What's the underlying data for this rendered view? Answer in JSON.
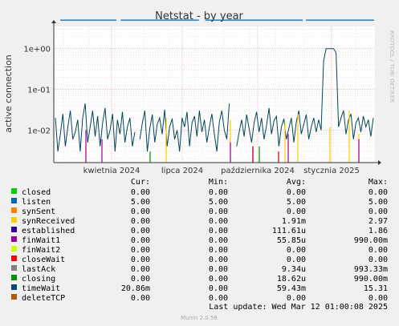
{
  "chart_data": {
    "type": "line",
    "title": "Netstat - by year",
    "ylabel": "active connection",
    "yscale": "log",
    "ylim": [
      0.0016,
      3.5
    ],
    "y_ticks": [
      {
        "v": 1,
        "label": "1e+00"
      },
      {
        "v": 0.1,
        "label": "1e-01"
      },
      {
        "v": 0.01,
        "label": "1e-02"
      }
    ],
    "x_ticks": [
      "kwietnia 2024",
      "lipca 2024",
      "października 2024",
      "stycznia 2025"
    ],
    "side_label": "RRDTOOL / TOBI OETIKER",
    "grid": true,
    "series": [
      {
        "name": "listen",
        "color": "#0066b3",
        "segments": [
          [
            0.02,
            0.195
          ],
          [
            0.208,
            0.452
          ],
          [
            0.472,
            0.775
          ],
          [
            0.785,
            0.997
          ]
        ],
        "level": 5.0
      },
      {
        "name": "timeWait",
        "color": "#00455a",
        "values": [
          0.02,
          0.003,
          0.008,
          0.025,
          0.004,
          0.012,
          0.03,
          0.006,
          0.009,
          0.018,
          0.003,
          0.02,
          0.045,
          0.005,
          0.012,
          0.03,
          0.007,
          0.022,
          0.004,
          0.015,
          0.035,
          0.006,
          0.01,
          0.025,
          0.003,
          0.018,
          0.008,
          0.028,
          0.005,
          0.012,
          0.02,
          0.004,
          0.009,
          0.022,
          0.006,
          0.015,
          0.03,
          0.003,
          0.011,
          0.024,
          0.005,
          0.014,
          0.02,
          0.008,
          0.032,
          0.004,
          0.012,
          0.019,
          0.006,
          0.01,
          0.003,
          0.02,
          0.012,
          0.028,
          0.004,
          0.015,
          0.022,
          0.007,
          0.03,
          0.009,
          0.018,
          0.005,
          0.012,
          0.025,
          0.008,
          0.003,
          0.016,
          0.03,
          0.01,
          0.006,
          0.045,
          0.012,
          0.02,
          0.004,
          0.009,
          0.018,
          0.007,
          0.024,
          0.011,
          0.005,
          0.015,
          0.028,
          0.009,
          0.02,
          0.006,
          0.013,
          0.035,
          0.008,
          0.017,
          0.022,
          0.004,
          0.012,
          0.019,
          0.006,
          0.011,
          0.02,
          0.005,
          0.016,
          0.03,
          0.008,
          0.014,
          0.024,
          0.006,
          0.012,
          0.02,
          0.009,
          0.018,
          0.01,
          0.5,
          1.0,
          1.0,
          1.0,
          1.0,
          0.8,
          0.012,
          0.02,
          0.03,
          0.008,
          0.018,
          0.025,
          0.006,
          0.015,
          0.02,
          0.009,
          0.022,
          0.012,
          0.018,
          0.007,
          0.02
        ],
        "gaps": [
          [
            0.255,
            0.265
          ],
          [
            0.55,
            0.565
          ]
        ]
      },
      {
        "name": "synReceived",
        "color": "#ffcc00",
        "spikes": [
          [
            0.1,
            0.004
          ],
          [
            0.35,
            0.02
          ],
          [
            0.55,
            0.018
          ],
          [
            0.72,
            0.015
          ],
          [
            0.76,
            0.025
          ],
          [
            0.86,
            0.012
          ],
          [
            0.92,
            0.03
          ],
          [
            0.95,
            0.008
          ]
        ]
      },
      {
        "name": "finWait1",
        "color": "#990099",
        "spikes": [
          [
            0.1,
            0.01
          ],
          [
            0.15,
            0.006
          ],
          [
            0.55,
            0.005
          ],
          [
            0.62,
            0.004
          ],
          [
            0.73,
            0.008
          ],
          [
            0.95,
            0.006
          ]
        ]
      },
      {
        "name": "lastAck",
        "color": "#cc0000",
        "spikes": [
          [
            0.62,
            0.004
          ],
          [
            0.7,
            0.003
          ]
        ]
      },
      {
        "name": "closing",
        "color": "#008f00",
        "spikes": [
          [
            0.3,
            0.003
          ],
          [
            0.64,
            0.004
          ]
        ]
      }
    ],
    "legend": {
      "headers": [
        "Cur:",
        "Min:",
        "Avg:",
        "Max:"
      ],
      "rows": [
        {
          "name": "closed",
          "color": "#00cc00",
          "cur": "0.00",
          "min": "0.00",
          "avg": "0.00",
          "max": "0.00"
        },
        {
          "name": "listen",
          "color": "#0066b3",
          "cur": "5.00",
          "min": "5.00",
          "avg": "5.00",
          "max": "5.00"
        },
        {
          "name": "synSent",
          "color": "#ff8000",
          "cur": "0.00",
          "min": "0.00",
          "avg": "0.00",
          "max": "0.00"
        },
        {
          "name": "synReceived",
          "color": "#ffcc00",
          "cur": "0.00",
          "min": "0.00",
          "avg": "1.91m",
          "max": "2.97"
        },
        {
          "name": "established",
          "color": "#330099",
          "cur": "0.00",
          "min": "0.00",
          "avg": "111.61u",
          "max": "1.86"
        },
        {
          "name": "finWait1",
          "color": "#990099",
          "cur": "0.00",
          "min": "0.00",
          "avg": "55.85u",
          "max": "990.00m"
        },
        {
          "name": "finWait2",
          "color": "#ccff00",
          "cur": "0.00",
          "min": "0.00",
          "avg": "0.00",
          "max": "0.00"
        },
        {
          "name": "closeWait",
          "color": "#ff0000",
          "cur": "0.00",
          "min": "0.00",
          "avg": "0.00",
          "max": "0.00"
        },
        {
          "name": "lastAck",
          "color": "#808080",
          "cur": "0.00",
          "min": "0.00",
          "avg": "9.34u",
          "max": "993.33m"
        },
        {
          "name": "closing",
          "color": "#008f00",
          "cur": "0.00",
          "min": "0.00",
          "avg": "18.62u",
          "max": "990.00m"
        },
        {
          "name": "timeWait",
          "color": "#00487d",
          "cur": "20.86m",
          "min": "0.00",
          "avg": "59.43m",
          "max": "15.31"
        },
        {
          "name": "deleteTCP",
          "color": "#b35a00",
          "cur": "0.00",
          "min": "0.00",
          "avg": "0.00",
          "max": "0.00"
        }
      ]
    },
    "last_update": "Last update: Wed Mar 12 01:00:08 2025",
    "footer": "Munin 2.0.56"
  }
}
